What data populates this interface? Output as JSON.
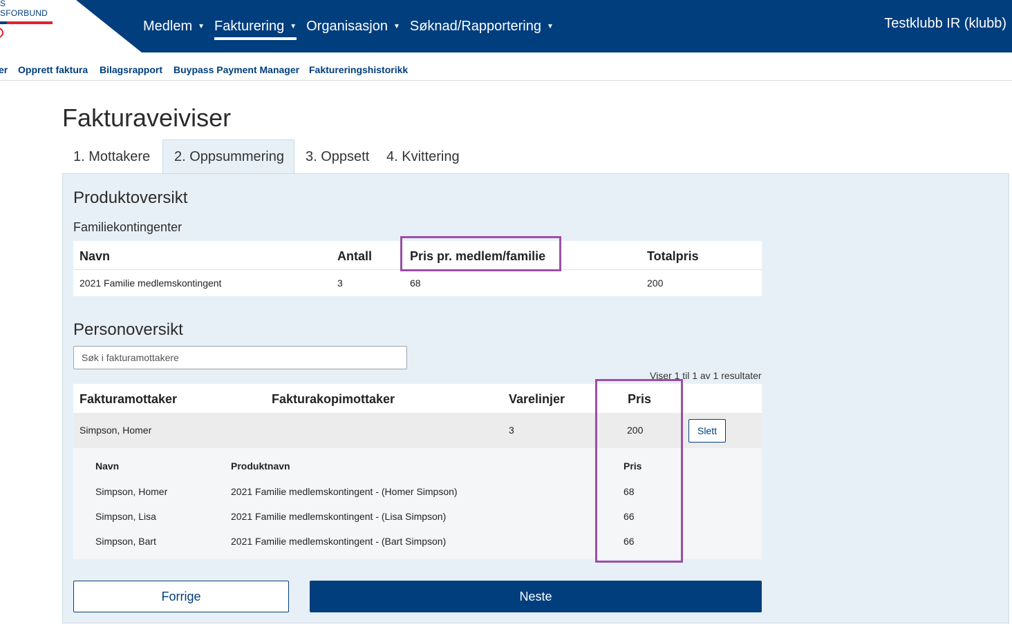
{
  "colors": {
    "brand": "#003e7e",
    "accent_red": "#e3212f",
    "panel_bg": "#e8f0f7",
    "highlight": "#9b4ea6"
  },
  "logo": {
    "line1": "S",
    "line2": "SFORBUND"
  },
  "header": {
    "nav": [
      {
        "label": "Medlem"
      },
      {
        "label": "Fakturering"
      },
      {
        "label": "Organisasjon"
      },
      {
        "label": "Søknad/Rapportering"
      }
    ],
    "club": "Testklubb IR (klubb)"
  },
  "subnav": [
    {
      "label": "er"
    },
    {
      "label": "Opprett faktura"
    },
    {
      "label": "Bilagsrapport"
    },
    {
      "label": "Buypass Payment Manager"
    },
    {
      "label": "Faktureringshistorikk"
    }
  ],
  "page": {
    "title": "Fakturaveiviser"
  },
  "tabs": [
    {
      "label": "1. Mottakere"
    },
    {
      "label": "2. Oppsummering"
    },
    {
      "label": "3. Oppsett"
    },
    {
      "label": "4. Kvittering"
    }
  ],
  "product": {
    "heading": "Produktoversikt",
    "subheading": "Familiekontingenter",
    "columns": [
      "Navn",
      "Antall",
      "Pris pr. medlem/familie",
      "Totalpris"
    ],
    "rows": [
      {
        "name": "2021 Familie medlemskontingent",
        "antall": "3",
        "pris": "68",
        "total": "200"
      }
    ]
  },
  "person": {
    "heading": "Personoversikt",
    "search_placeholder": "Søk i fakturamottakere",
    "results": "Viser 1 til 1 av 1 resultater",
    "columns": [
      "Fakturamottaker",
      "Fakturakopimottaker",
      "Varelinjer",
      "Pris"
    ],
    "row": {
      "mottaker": "Simpson, Homer",
      "kopimottaker": "",
      "varelinjer": "3",
      "pris": "200",
      "delete_label": "Slett"
    },
    "sub_columns": [
      "Navn",
      "Produktnavn",
      "Pris"
    ],
    "sub_rows": [
      {
        "navn": "Simpson, Homer",
        "produkt": "2021 Familie medlemskontingent - (Homer Simpson)",
        "pris": "68"
      },
      {
        "navn": "Simpson, Lisa",
        "produkt": "2021 Familie medlemskontingent - (Lisa Simpson)",
        "pris": "66"
      },
      {
        "navn": "Simpson, Bart",
        "produkt": "2021 Familie medlemskontingent - (Bart Simpson)",
        "pris": "66"
      }
    ]
  },
  "buttons": {
    "prev": "Forrige",
    "next": "Neste"
  }
}
